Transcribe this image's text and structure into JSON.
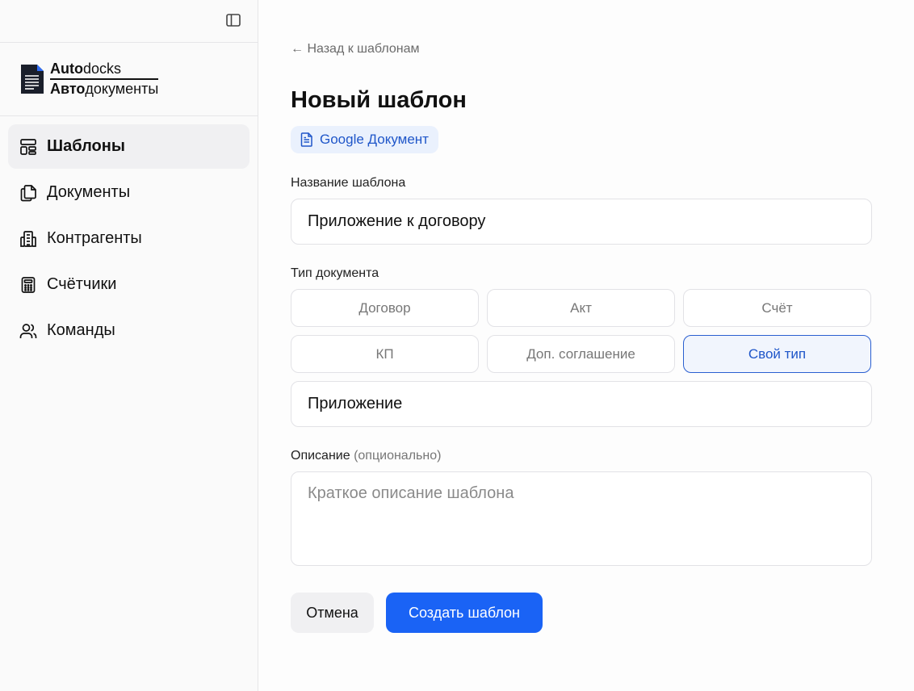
{
  "brand": {
    "line1_bold": "Auto",
    "line1_rest": "docks",
    "line2_bold": "Авто",
    "line2_rest": "документы"
  },
  "sidebar": {
    "items": [
      {
        "label": "Шаблоны",
        "icon": "layout-icon",
        "active": true
      },
      {
        "label": "Документы",
        "icon": "files-icon",
        "active": false
      },
      {
        "label": "Контрагенты",
        "icon": "building-icon",
        "active": false
      },
      {
        "label": "Счётчики",
        "icon": "calculator-icon",
        "active": false
      },
      {
        "label": "Команды",
        "icon": "users-icon",
        "active": false
      }
    ]
  },
  "main": {
    "back_link": "← Назад к шаблонам",
    "title": "Новый шаблон",
    "doc_badge": "Google Документ",
    "name_label": "Название шаблона",
    "name_value": "Приложение к договору",
    "type_label": "Тип документа",
    "types": [
      "Договор",
      "Акт",
      "Счёт",
      "КП",
      "Доп. соглашение",
      "Свой тип"
    ],
    "selected_type": "Свой тип",
    "custom_type_value": "Приложение",
    "description_label": "Описание",
    "description_optional": "(опционально)",
    "description_placeholder": "Краткое описание шаблона",
    "cancel_label": "Отмена",
    "create_label": "Создать шаблон"
  },
  "colors": {
    "accent": "#1a63f5",
    "selected_border": "#2a5fd0",
    "badge_bg": "#eaf1fd"
  }
}
